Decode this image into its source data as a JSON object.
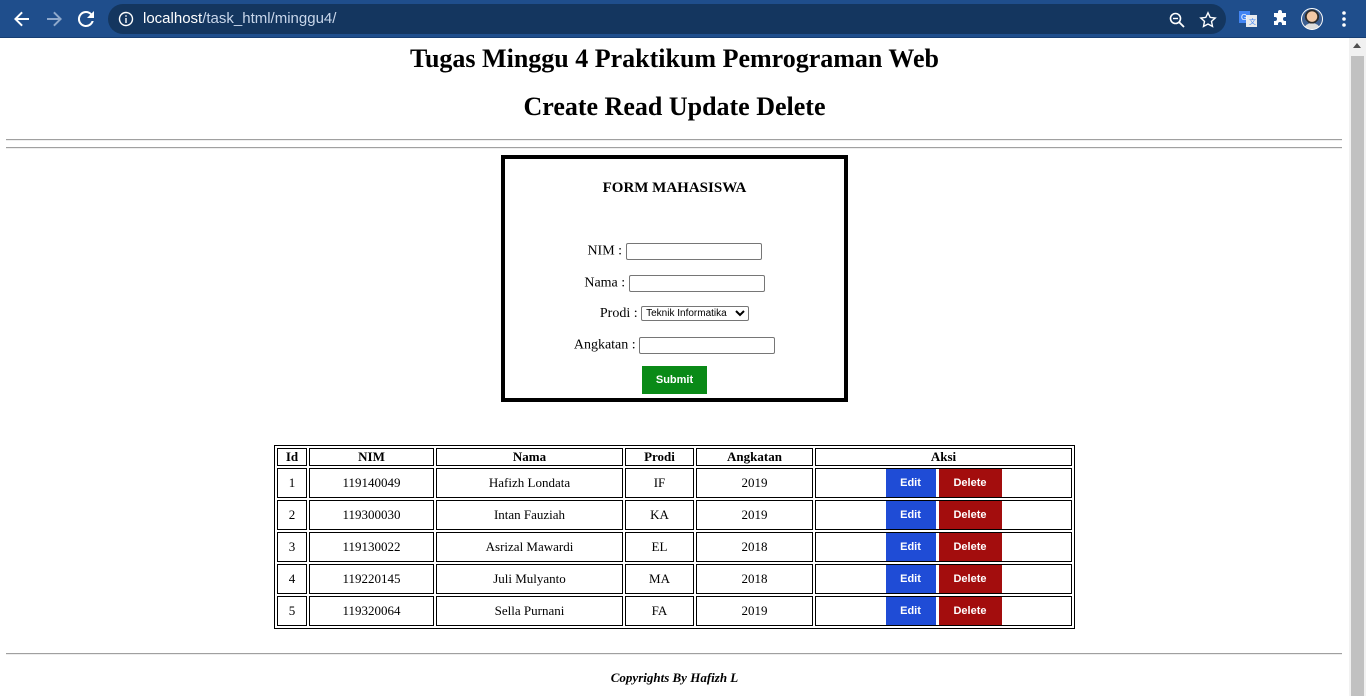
{
  "browser": {
    "url_host": "localhost",
    "url_path": "/task_html/minggu4/"
  },
  "page": {
    "title": "Tugas Minggu 4 Praktikum Pemrograman Web",
    "subtitle": "Create Read Update Delete"
  },
  "form": {
    "title": "FORM MAHASISWA",
    "nim_label": "NIM :",
    "nama_label": "Nama :",
    "prodi_label": "Prodi :",
    "prodi_selected": "Teknik Informatika",
    "angkatan_label": "Angkatan :",
    "submit_label": "Submit"
  },
  "table": {
    "headers": [
      "Id",
      "NIM",
      "Nama",
      "Prodi",
      "Angkatan",
      "Aksi"
    ],
    "rows": [
      {
        "id": "1",
        "nim": "119140049",
        "nama": "Hafizh Londata",
        "prodi": "IF",
        "angkatan": "2019"
      },
      {
        "id": "2",
        "nim": "119300030",
        "nama": "Intan Fauziah",
        "prodi": "KA",
        "angkatan": "2019"
      },
      {
        "id": "3",
        "nim": "119130022",
        "nama": "Asrizal Mawardi",
        "prodi": "EL",
        "angkatan": "2018"
      },
      {
        "id": "4",
        "nim": "119220145",
        "nama": "Juli Mulyanto",
        "prodi": "MA",
        "angkatan": "2018"
      },
      {
        "id": "5",
        "nim": "119320064",
        "nama": "Sella Purnani",
        "prodi": "FA",
        "angkatan": "2019"
      }
    ],
    "edit_label": "Edit",
    "delete_label": "Delete"
  },
  "footer": {
    "text": "Copyrights By Hafizh L"
  },
  "colors": {
    "toolbar": "#1f4e8c",
    "submit": "#0a8a17",
    "edit": "#1f4cd6",
    "delete": "#a30d0d"
  }
}
